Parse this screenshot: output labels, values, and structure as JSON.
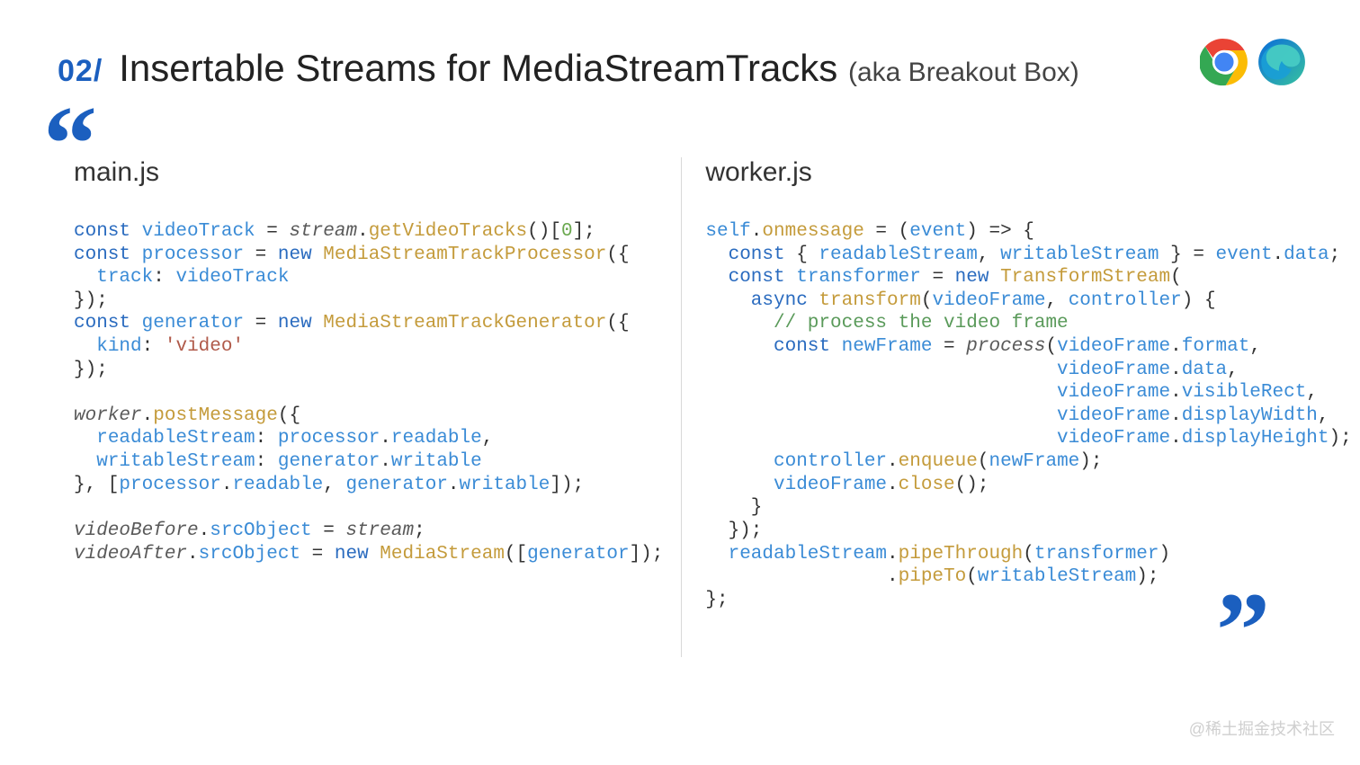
{
  "header": {
    "section_num": "02/",
    "title": "Insertable Streams for MediaStreamTracks",
    "subtitle": "(aka Breakout Box)"
  },
  "icons": {
    "chrome": "chrome-icon",
    "edge": "edge-icon"
  },
  "left": {
    "filename": "main.js",
    "code_lines": [
      [
        [
          "kw",
          "const "
        ],
        [
          "ident",
          "videoTrack"
        ],
        [
          "punct",
          " = "
        ],
        [
          "it",
          "stream"
        ],
        [
          "punct",
          "."
        ],
        [
          "method",
          "getVideoTracks"
        ],
        [
          "punct",
          "()["
        ],
        [
          "num",
          "0"
        ],
        [
          "punct",
          "];"
        ]
      ],
      [
        [
          "kw",
          "const "
        ],
        [
          "ident",
          "processor"
        ],
        [
          "punct",
          " = "
        ],
        [
          "kw",
          "new "
        ],
        [
          "cls",
          "MediaStreamTrackProcessor"
        ],
        [
          "punct",
          "({"
        ]
      ],
      [
        [
          "punct",
          "  "
        ],
        [
          "prop",
          "track"
        ],
        [
          "punct",
          ": "
        ],
        [
          "ident",
          "videoTrack"
        ]
      ],
      [
        [
          "punct",
          "});"
        ]
      ],
      [
        [
          "kw",
          "const "
        ],
        [
          "ident",
          "generator"
        ],
        [
          "punct",
          " = "
        ],
        [
          "kw",
          "new "
        ],
        [
          "cls",
          "MediaStreamTrackGenerator"
        ],
        [
          "punct",
          "({"
        ]
      ],
      [
        [
          "punct",
          "  "
        ],
        [
          "prop",
          "kind"
        ],
        [
          "punct",
          ": "
        ],
        [
          "str",
          "'video'"
        ]
      ],
      [
        [
          "punct",
          "});"
        ]
      ],
      [
        [
          "punct",
          ""
        ]
      ],
      [
        [
          "it",
          "worker"
        ],
        [
          "punct",
          "."
        ],
        [
          "method",
          "postMessage"
        ],
        [
          "punct",
          "({"
        ]
      ],
      [
        [
          "punct",
          "  "
        ],
        [
          "prop",
          "readableStream"
        ],
        [
          "punct",
          ": "
        ],
        [
          "ident",
          "processor"
        ],
        [
          "punct",
          "."
        ],
        [
          "prop",
          "readable"
        ],
        [
          "punct",
          ","
        ]
      ],
      [
        [
          "punct",
          "  "
        ],
        [
          "prop",
          "writableStream"
        ],
        [
          "punct",
          ": "
        ],
        [
          "ident",
          "generator"
        ],
        [
          "punct",
          "."
        ],
        [
          "prop",
          "writable"
        ]
      ],
      [
        [
          "punct",
          "}, ["
        ],
        [
          "ident",
          "processor"
        ],
        [
          "punct",
          "."
        ],
        [
          "prop",
          "readable"
        ],
        [
          "punct",
          ", "
        ],
        [
          "ident",
          "generator"
        ],
        [
          "punct",
          "."
        ],
        [
          "prop",
          "writable"
        ],
        [
          "punct",
          "]);"
        ]
      ],
      [
        [
          "punct",
          ""
        ]
      ],
      [
        [
          "it",
          "videoBefore"
        ],
        [
          "punct",
          "."
        ],
        [
          "prop",
          "srcObject"
        ],
        [
          "punct",
          " = "
        ],
        [
          "it",
          "stream"
        ],
        [
          "punct",
          ";"
        ]
      ],
      [
        [
          "it",
          "videoAfter"
        ],
        [
          "punct",
          "."
        ],
        [
          "prop",
          "srcObject"
        ],
        [
          "punct",
          " = "
        ],
        [
          "kw",
          "new "
        ],
        [
          "cls",
          "MediaStream"
        ],
        [
          "punct",
          "(["
        ],
        [
          "ident",
          "generator"
        ],
        [
          "punct",
          "]);"
        ]
      ]
    ]
  },
  "right": {
    "filename": "worker.js",
    "code_lines": [
      [
        [
          "ident",
          "self"
        ],
        [
          "punct",
          "."
        ],
        [
          "method",
          "onmessage"
        ],
        [
          "punct",
          " = ("
        ],
        [
          "ident",
          "event"
        ],
        [
          "punct",
          ") => {"
        ]
      ],
      [
        [
          "punct",
          "  "
        ],
        [
          "kw",
          "const"
        ],
        [
          "punct",
          " { "
        ],
        [
          "ident",
          "readableStream"
        ],
        [
          "punct",
          ", "
        ],
        [
          "ident",
          "writableStream"
        ],
        [
          "punct",
          " } = "
        ],
        [
          "ident",
          "event"
        ],
        [
          "punct",
          "."
        ],
        [
          "prop",
          "data"
        ],
        [
          "punct",
          ";"
        ]
      ],
      [
        [
          "punct",
          "  "
        ],
        [
          "kw",
          "const "
        ],
        [
          "ident",
          "transformer"
        ],
        [
          "punct",
          " = "
        ],
        [
          "kw",
          "new "
        ],
        [
          "cls",
          "TransformStream"
        ],
        [
          "punct",
          "("
        ]
      ],
      [
        [
          "punct",
          "    "
        ],
        [
          "kw",
          "async "
        ],
        [
          "method",
          "transform"
        ],
        [
          "punct",
          "("
        ],
        [
          "ident",
          "videoFrame"
        ],
        [
          "punct",
          ", "
        ],
        [
          "ident",
          "controller"
        ],
        [
          "punct",
          ") {"
        ]
      ],
      [
        [
          "punct",
          "      "
        ],
        [
          "comment",
          "// process the video frame"
        ]
      ],
      [
        [
          "punct",
          "      "
        ],
        [
          "kw",
          "const "
        ],
        [
          "ident",
          "newFrame"
        ],
        [
          "punct",
          " = "
        ],
        [
          "it",
          "process"
        ],
        [
          "punct",
          "("
        ],
        [
          "ident",
          "videoFrame"
        ],
        [
          "punct",
          "."
        ],
        [
          "prop",
          "format"
        ],
        [
          "punct",
          ","
        ]
      ],
      [
        [
          "punct",
          "                               "
        ],
        [
          "ident",
          "videoFrame"
        ],
        [
          "punct",
          "."
        ],
        [
          "prop",
          "data"
        ],
        [
          "punct",
          ","
        ]
      ],
      [
        [
          "punct",
          "                               "
        ],
        [
          "ident",
          "videoFrame"
        ],
        [
          "punct",
          "."
        ],
        [
          "prop",
          "visibleRect"
        ],
        [
          "punct",
          ","
        ]
      ],
      [
        [
          "punct",
          "                               "
        ],
        [
          "ident",
          "videoFrame"
        ],
        [
          "punct",
          "."
        ],
        [
          "prop",
          "displayWidth"
        ],
        [
          "punct",
          ","
        ]
      ],
      [
        [
          "punct",
          "                               "
        ],
        [
          "ident",
          "videoFrame"
        ],
        [
          "punct",
          "."
        ],
        [
          "prop",
          "displayHeight"
        ],
        [
          "punct",
          ");"
        ]
      ],
      [
        [
          "punct",
          "      "
        ],
        [
          "ident",
          "controller"
        ],
        [
          "punct",
          "."
        ],
        [
          "method",
          "enqueue"
        ],
        [
          "punct",
          "("
        ],
        [
          "ident",
          "newFrame"
        ],
        [
          "punct",
          ");"
        ]
      ],
      [
        [
          "punct",
          "      "
        ],
        [
          "ident",
          "videoFrame"
        ],
        [
          "punct",
          "."
        ],
        [
          "method",
          "close"
        ],
        [
          "punct",
          "();"
        ]
      ],
      [
        [
          "punct",
          "    }"
        ]
      ],
      [
        [
          "punct",
          "  });"
        ]
      ],
      [
        [
          "punct",
          "  "
        ],
        [
          "ident",
          "readableStream"
        ],
        [
          "punct",
          "."
        ],
        [
          "method",
          "pipeThrough"
        ],
        [
          "punct",
          "("
        ],
        [
          "ident",
          "transformer"
        ],
        [
          "punct",
          ")"
        ]
      ],
      [
        [
          "punct",
          "                ."
        ],
        [
          "method",
          "pipeTo"
        ],
        [
          "punct",
          "("
        ],
        [
          "ident",
          "writableStream"
        ],
        [
          "punct",
          ");"
        ]
      ],
      [
        [
          "punct",
          "};"
        ]
      ]
    ]
  },
  "watermark": "@稀土掘金技术社区"
}
